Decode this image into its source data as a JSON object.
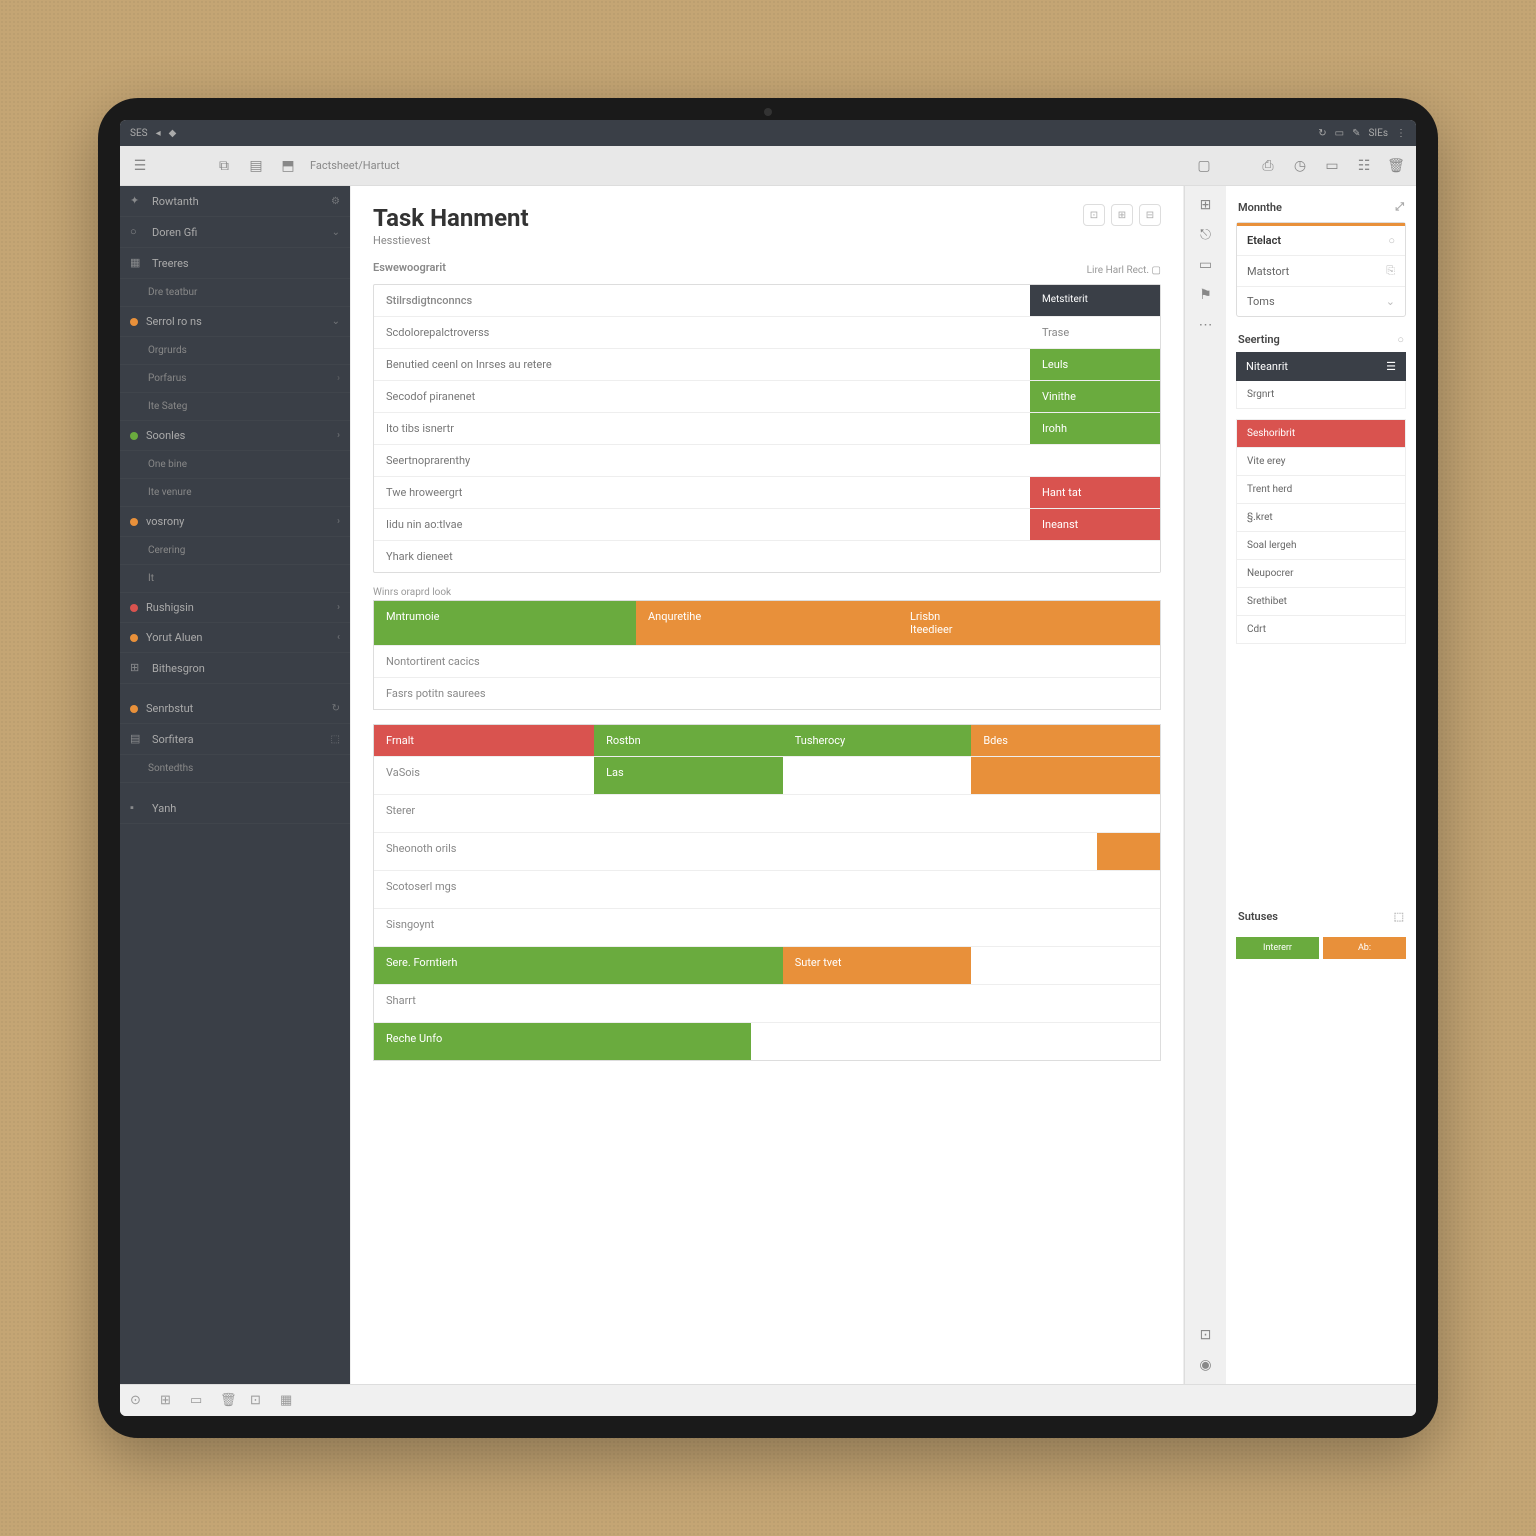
{
  "status": {
    "left": "SES",
    "right": "SIEs"
  },
  "toolbar": {
    "crumb": "Factsheet/Hartuct"
  },
  "sidebar": {
    "items": [
      {
        "icon": "star",
        "label": "Rowtanth",
        "chev": "⚙"
      },
      {
        "icon": "circle",
        "label": "Doren Gfi",
        "chev": "⌄"
      },
      {
        "icon": "cal",
        "label": "Treeres"
      },
      {
        "child": true,
        "label": "Dre teatbur"
      },
      {
        "dot": "#e8903a",
        "label": "Serrol ro ns",
        "chev": "⌄"
      },
      {
        "child": true,
        "label": "Orgrurds"
      },
      {
        "child": true,
        "label": "Porfarus",
        "chev": "›"
      },
      {
        "child": true,
        "label": "Ite Sateg"
      },
      {
        "dot": "#6aab3e",
        "label": "Soonles",
        "chev": "›"
      },
      {
        "child": true,
        "label": "One bine"
      },
      {
        "child": true,
        "label": "Ite venure"
      },
      {
        "dot": "#e8903a",
        "label": "vosrony",
        "chev": "›"
      },
      {
        "child": true,
        "label": "Cerering"
      },
      {
        "child": true,
        "label": "It"
      },
      {
        "dot": "#d9534f",
        "label": "Rushigsin",
        "chev": "›"
      },
      {
        "dot": "#e8903a",
        "label": "Yorut Aluen",
        "chev": "‹"
      },
      {
        "icon": "grid",
        "label": "Bithesgron"
      },
      {
        "blank": true
      },
      {
        "dot": "#e8903a",
        "label": "Senrbstut",
        "chev": "↻"
      },
      {
        "icon": "doc",
        "label": "Sorfitera",
        "chev": "⬚"
      },
      {
        "child": true,
        "label": "Sontedths"
      },
      {
        "blank": true
      },
      {
        "icon": "box",
        "label": "Yanh"
      }
    ]
  },
  "content": {
    "title": "Task Hanment",
    "sub": "Hesstievest",
    "sec": "Eswewoograrit",
    "topmeta": "Lire Harl Rect.",
    "table1": {
      "head": [
        "Stilrsdigtnconncs",
        "Metstiterit"
      ],
      "rows": [
        [
          "Scdolorepalctroverss",
          "Trase",
          "plain"
        ],
        [
          "Benutied ceenl on Inrses au retere",
          "Leuls",
          "green"
        ],
        [
          "Secodof piranenet",
          "Vinithe",
          "green"
        ],
        [
          "Ito tibs isnertr",
          "Irohh",
          "green"
        ],
        [
          "Seertnoprarenthy",
          "",
          ""
        ],
        [
          "Twe hroweergrt",
          "Hant tat",
          "red"
        ],
        [
          "Iidu nin ao:tlvae",
          "Ineanst",
          "red"
        ],
        [
          "Yhark dieneet",
          "",
          ""
        ]
      ]
    },
    "tiny": "Winrs oraprd look",
    "table2": {
      "head": [
        {
          "label": "Mntrumoie",
          "color": "green"
        },
        {
          "label": "Anquretihe",
          "color": "orange"
        },
        {
          "label": "Lrisbn\nIteedieer",
          "color": "orange"
        }
      ],
      "rows": [
        [
          "Nontortirent cacics",
          "",
          ""
        ],
        [
          "Fasrs potitn saurees",
          "",
          ""
        ]
      ]
    },
    "table3": {
      "head": [
        {
          "label": "Frnalt",
          "color": "red"
        },
        {
          "label": "Rostbn",
          "color": "green"
        },
        {
          "label": "Tusherocy",
          "color": "green"
        },
        {
          "label": "Bdes",
          "color": "orange"
        }
      ],
      "rows": [
        [
          {
            "t": "VaSois"
          },
          {
            "t": "Las",
            "c": "green"
          },
          {
            "t": ""
          },
          {
            "t": "",
            "c": "orange"
          }
        ],
        [
          {
            "t": "Sterer"
          },
          {
            "t": ""
          },
          {
            "t": ""
          },
          {
            "t": ""
          }
        ],
        [
          {
            "t": "Sheonoth orils"
          },
          {
            "t": ""
          },
          {
            "t": ""
          },
          {
            "t": "",
            "c": "orange",
            "narrow": true
          }
        ],
        [
          {
            "t": "Scotoserl mgs"
          },
          {
            "t": ""
          },
          {
            "t": ""
          },
          {
            "t": ""
          }
        ],
        [
          {
            "t": "Sisngoynt"
          },
          {
            "t": ""
          },
          {
            "t": ""
          },
          {
            "t": ""
          }
        ],
        [
          {
            "t": "Sere. Forntierh",
            "c": "green",
            "span2": true
          },
          {
            "t": "Suter tvet",
            "c": "orange"
          },
          {
            "t": ""
          }
        ],
        [
          {
            "t": "Sharrt"
          },
          {
            "t": ""
          },
          {
            "t": ""
          },
          {
            "t": ""
          }
        ],
        [
          {
            "t": "Reche Unfo",
            "c": "green",
            "wide": true
          },
          {
            "t": ""
          },
          {
            "t": ""
          }
        ]
      ]
    }
  },
  "right": {
    "head": "Monnthe",
    "card": [
      {
        "label": "Etelact",
        "accent": true,
        "chev": "○"
      },
      {
        "label": "Matstort",
        "chev": "⎘"
      },
      {
        "label": "Toms",
        "chev": "⌄"
      }
    ],
    "sec1": "Seerting",
    "dark": "Niteanrit",
    "row1": "Srgnrt",
    "list": [
      {
        "label": "Seshoribrit",
        "color": "red"
      },
      {
        "label": "Vite erey"
      },
      {
        "label": "Trent herd"
      },
      {
        "label": "§.kret"
      },
      {
        "label": "Soal lergeh"
      },
      {
        "label": "Neupocrer"
      },
      {
        "label": "Srethibet"
      },
      {
        "label": "Cdrt"
      }
    ],
    "foot_label": "Sutuses",
    "foot": [
      {
        "label": "Intererr",
        "c": "green"
      },
      {
        "label": "Ab:",
        "c": "orange"
      }
    ]
  }
}
